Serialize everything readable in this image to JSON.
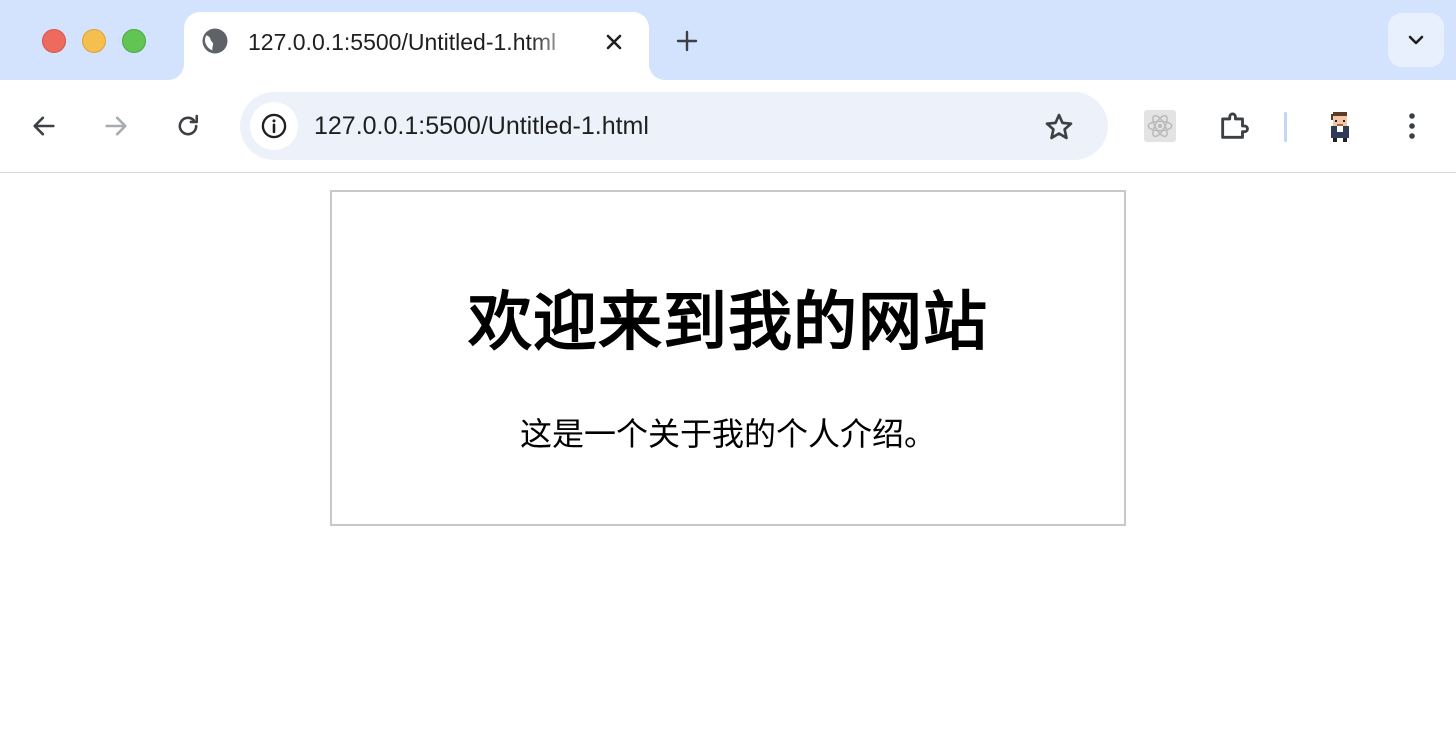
{
  "browser": {
    "tab": {
      "title": "127.0.0.1:5500/Untitled-1.html",
      "favicon": "globe-icon"
    },
    "address_bar": {
      "url": "127.0.0.1:5500/Untitled-1.html"
    },
    "icons": {
      "back": "arrow-left-icon",
      "forward": "arrow-right-icon",
      "reload": "reload-icon",
      "site_info": "info-icon",
      "bookmark": "star-icon",
      "react_devtools": "react-icon",
      "extensions": "puzzle-icon",
      "profile": "avatar-icon",
      "menu": "kebab-icon"
    },
    "colors": {
      "tabstrip": "#d3e3fd",
      "omnibox": "#edf2fa",
      "close_light": "#ed6a5e",
      "minimize_light": "#f5bf4f",
      "zoom_light": "#61c554"
    }
  },
  "page": {
    "heading": "欢迎来到我的网站",
    "intro": "这是一个关于我的个人介绍。",
    "border_color": "#c8c8c8"
  }
}
